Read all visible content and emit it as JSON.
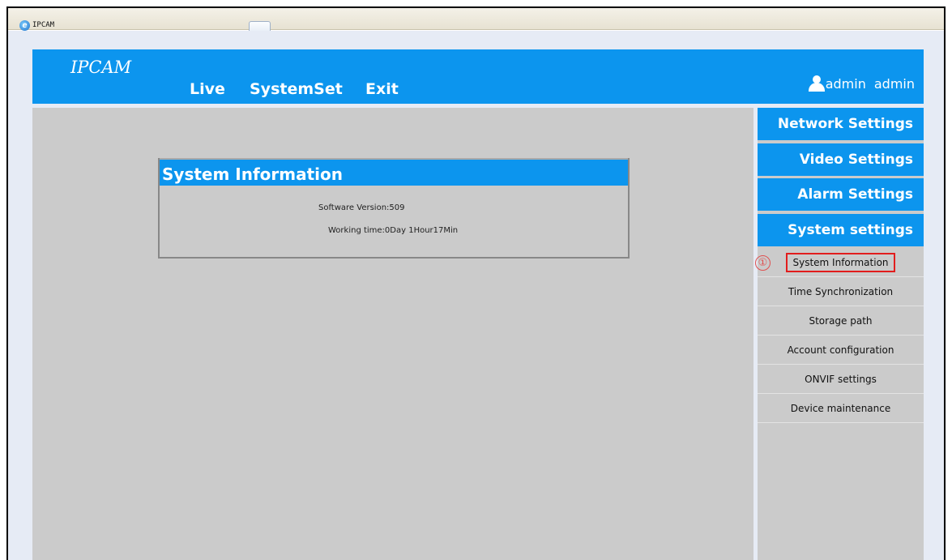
{
  "browser": {
    "tab_title": "IPCAM",
    "icon": "ie-icon"
  },
  "header": {
    "brand": "IPCAM",
    "nav": [
      {
        "label": "Live"
      },
      {
        "label": "SystemSet"
      },
      {
        "label": "Exit"
      }
    ],
    "user_label": "admin",
    "user_name": "admin",
    "user_icon": "user-icon"
  },
  "panel": {
    "title": "System Information",
    "software_version": "Software Version:509",
    "working_time": "Working time:0Day 1Hour17Min"
  },
  "sidebar": {
    "categories": [
      {
        "label": "Network Settings"
      },
      {
        "label": "Video Settings"
      },
      {
        "label": "Alarm Settings"
      },
      {
        "label": "System settings"
      }
    ],
    "submenu": [
      {
        "label": "System Information",
        "active": true
      },
      {
        "label": "Time Synchronization"
      },
      {
        "label": "Storage path"
      },
      {
        "label": "Account configuration"
      },
      {
        "label": "ONVIF settings"
      },
      {
        "label": "Device maintenance"
      }
    ],
    "marker": "①"
  },
  "colors": {
    "primary_blue": "#0c95ee",
    "content_gray": "#cbcbcb",
    "highlight_red": "#e21d1d"
  }
}
